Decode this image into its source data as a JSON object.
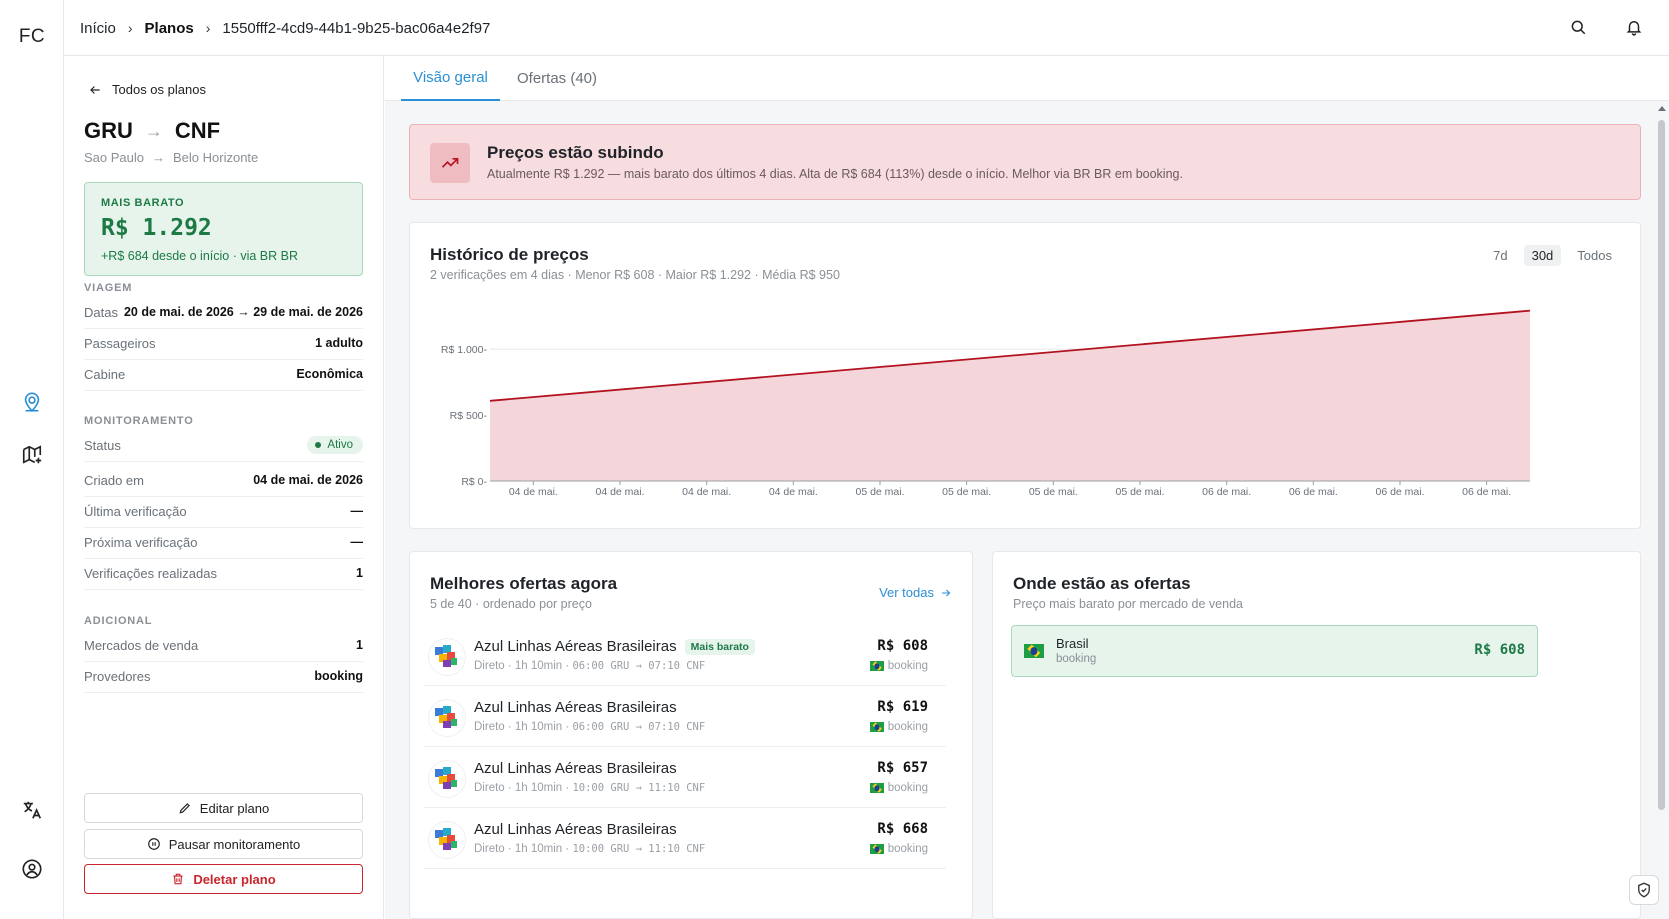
{
  "rail": {
    "logo": "FC",
    "icons": [
      "map-pin-icon",
      "map-add-icon",
      "translate-icon",
      "user-circle-icon"
    ]
  },
  "breadcrumb": {
    "home": "Início",
    "section": "Planos",
    "id": "1550fff2-4cd9-44b1-9b25-bac06a4e2f97"
  },
  "header": {
    "icons": [
      "search-icon",
      "bell-icon"
    ]
  },
  "plan": {
    "back_label": "Todos os planos",
    "origin": "GRU",
    "destination": "CNF",
    "origin_city": "Sao Paulo",
    "destination_city": "Belo Horizonte",
    "cheapest": {
      "label": "MAIS BARATO",
      "price": "R$ 1.292",
      "note": "+R$ 684 desde o início · via BR BR"
    },
    "trip": {
      "section": "VIAGEM",
      "rows": [
        {
          "k": "Datas",
          "v": "20 de mai. de 2026 → 29 de mai. de 2026"
        },
        {
          "k": "Passageiros",
          "v": "1 adulto"
        },
        {
          "k": "Cabine",
          "v": "Econômica"
        }
      ]
    },
    "monitoring": {
      "section": "MONITORAMENTO",
      "status_label": "Status",
      "status_value": "Ativo",
      "rows": [
        {
          "k": "Criado em",
          "v": "04 de mai. de 2026"
        },
        {
          "k": "Última verificação",
          "v": "—"
        },
        {
          "k": "Próxima verificação",
          "v": "—"
        },
        {
          "k": "Verificações realizadas",
          "v": "1"
        }
      ]
    },
    "additional": {
      "section": "ADICIONAL",
      "rows": [
        {
          "k": "Mercados de venda",
          "v": "1"
        },
        {
          "k": "Provedores",
          "v": "booking"
        }
      ]
    },
    "buttons": {
      "edit": "Editar plano",
      "pause": "Pausar monitoramento",
      "delete": "Deletar plano"
    }
  },
  "tabs": [
    {
      "label": "Visão geral",
      "active": true
    },
    {
      "label": "Ofertas (40)",
      "active": false
    }
  ],
  "alert": {
    "title": "Preços estão subindo",
    "text": "Atualmente R$ 1.292 — mais barato dos últimos 4 dias. Alta de R$ 684 (113%) desde o início. Melhor via BR BR em booking."
  },
  "history": {
    "title": "Histórico de preços",
    "subtitle": "2 verificações em 4 dias · Menor R$ 608 · Maior R$ 1.292 · Média R$ 950",
    "ranges": [
      "7d",
      "30d",
      "Todos"
    ],
    "selected_range": "30d"
  },
  "chart_data": {
    "type": "area",
    "title": "Histórico de preços",
    "x": [
      "04 de mai.",
      "04 de mai.",
      "04 de mai.",
      "04 de mai.",
      "05 de mai.",
      "05 de mai.",
      "05 de mai.",
      "05 de mai.",
      "06 de mai.",
      "06 de mai.",
      "06 de mai.",
      "06 de mai."
    ],
    "series": [
      {
        "values_start": 608,
        "values_end": 1292
      }
    ],
    "points": [
      {
        "x": 0,
        "y": 608
      },
      {
        "x": 1,
        "y": 1292
      }
    ],
    "y_ticks": [
      "R$ 0",
      "R$ 500",
      "R$ 1.000"
    ],
    "y_tick_values": [
      0,
      500,
      1000
    ],
    "ylim": [
      0,
      1350
    ],
    "grid": true,
    "colors": {
      "line": "#b3121f",
      "fill": "#f4d6da"
    }
  },
  "offers": {
    "title": "Melhores ofertas agora",
    "subtitle": "5 de 40 · ordenado por preço",
    "see_all": "Ver todas",
    "items": [
      {
        "airline": "Azul Linhas Aéreas Brasileiras",
        "tag": "Mais barato",
        "meta": "Direto · 1h 10min · ",
        "times": "06:00 GRU → 07:10 CNF",
        "price": "R$ 608",
        "provider": "booking"
      },
      {
        "airline": "Azul Linhas Aéreas Brasileiras",
        "tag": "",
        "meta": "Direto · 1h 10min · ",
        "times": "06:00 GRU → 07:10 CNF",
        "price": "R$ 619",
        "provider": "booking"
      },
      {
        "airline": "Azul Linhas Aéreas Brasileiras",
        "tag": "",
        "meta": "Direto · 1h 10min · ",
        "times": "10:00 GRU → 11:10 CNF",
        "price": "R$ 657",
        "provider": "booking"
      },
      {
        "airline": "Azul Linhas Aéreas Brasileiras",
        "tag": "",
        "meta": "Direto · 1h 10min · ",
        "times": "10:00 GRU → 11:10 CNF",
        "price": "R$ 668",
        "provider": "booking"
      }
    ]
  },
  "markets": {
    "title": "Onde estão as ofertas",
    "subtitle": "Preço mais barato por mercado de venda",
    "items": [
      {
        "name": "Brasil",
        "provider": "booking",
        "price": "R$ 608"
      }
    ]
  },
  "colors": {
    "accent": "#2b8fd6",
    "success": "#1d7a45",
    "danger": "#c8262c",
    "alert_bg": "#f8dde0"
  }
}
